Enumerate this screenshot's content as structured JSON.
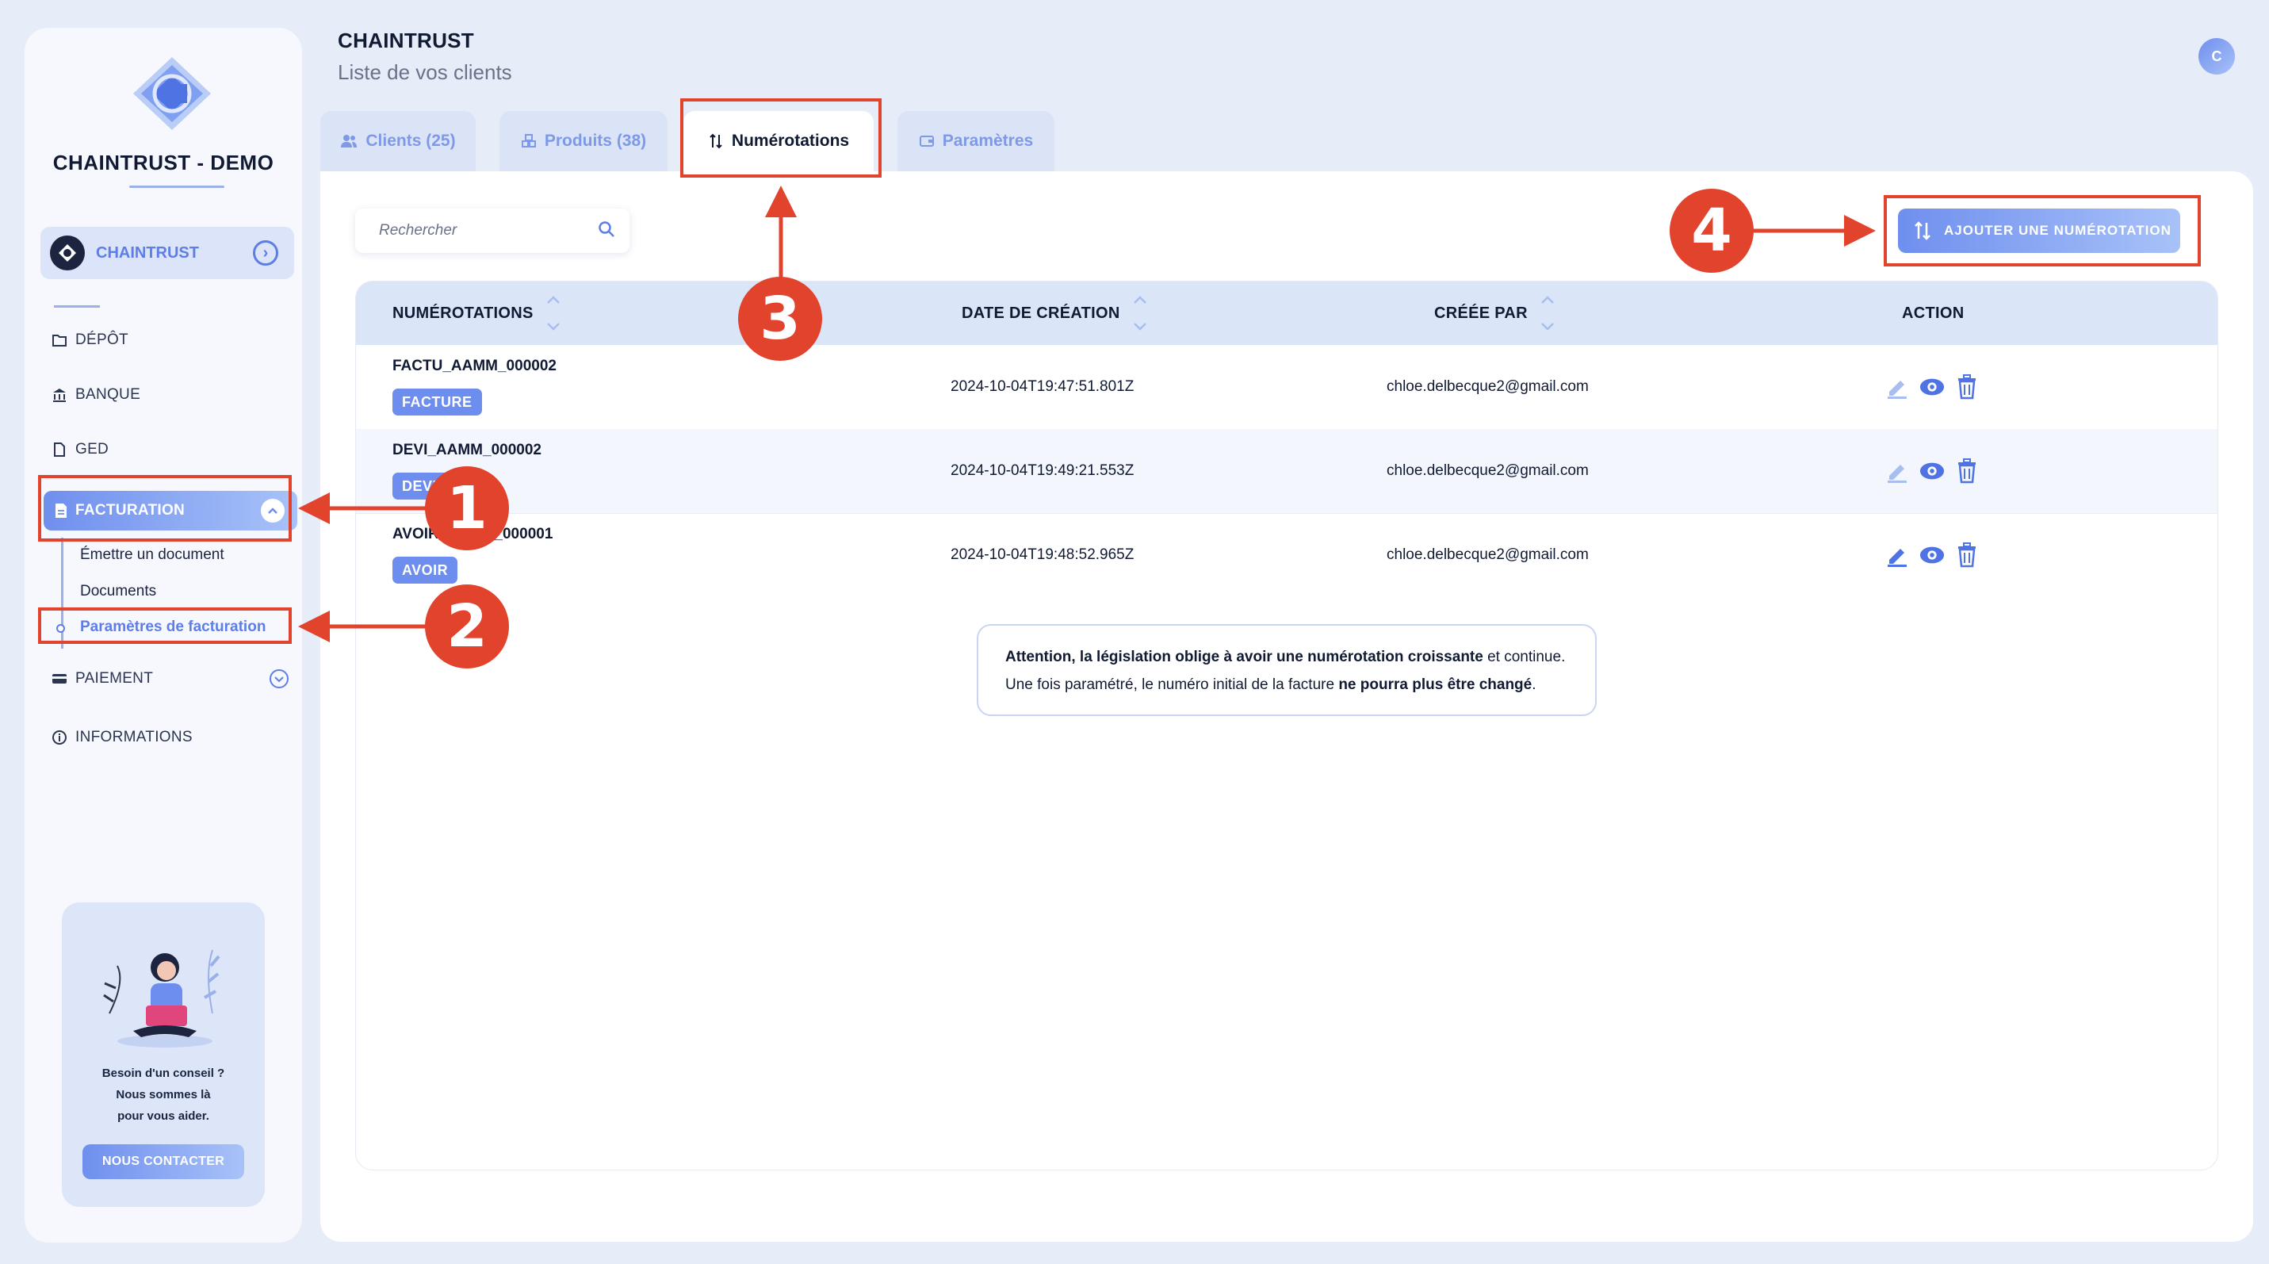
{
  "sidebar": {
    "brand": "CHAINTRUST - DEMO",
    "org_name": "CHAINTRUST",
    "nav": {
      "depot": "DÉPÔT",
      "banque": "BANQUE",
      "ged": "GED",
      "facturation": "FACTURATION",
      "paiement": "PAIEMENT",
      "informations": "INFORMATIONS"
    },
    "sub": {
      "emettre": "Émettre un document",
      "documents": "Documents",
      "parametres": "Paramètres de facturation"
    },
    "help": {
      "line1": "Besoin d'un conseil ?",
      "line2": "Nous sommes là",
      "line3": "pour vous aider.",
      "button": "NOUS CONTACTER"
    }
  },
  "header": {
    "title": "CHAINTRUST",
    "subtitle": "Liste de vos clients",
    "avatar_initial": "C"
  },
  "tabs": {
    "clients": "Clients (25)",
    "produits": "Produits (38)",
    "numerotations": "Numérotations",
    "parametres": "Paramètres"
  },
  "search": {
    "placeholder": "Rechercher"
  },
  "add_button": "AJOUTER UNE NUMÉROTATION",
  "table": {
    "headers": {
      "name": "NUMÉROTATIONS",
      "date": "DATE DE CRÉATION",
      "user": "CRÉÉE PAR",
      "action": "ACTION"
    },
    "rows": [
      {
        "name": "FACTU_AAMM_000002",
        "badge": "FACTURE",
        "date": "2024-10-04T19:47:51.801Z",
        "user": "chloe.delbecque2@gmail.com"
      },
      {
        "name": "DEVI_AAMM_000002",
        "badge": "DEVIS",
        "date": "2024-10-04T19:49:21.553Z",
        "user": "chloe.delbecque2@gmail.com"
      },
      {
        "name": "AVOIR_AAMM_000001",
        "badge": "AVOIR",
        "date": "2024-10-04T19:48:52.965Z",
        "user": "chloe.delbecque2@gmail.com"
      }
    ]
  },
  "warning": {
    "p1_bold": "Attention, la législation oblige à avoir une numérotation croissante",
    "p1_rest": " et continue.",
    "p2_start": "Une fois paramétré, le numéro initial de la facture ",
    "p2_bold": "ne pourra plus être changé",
    "p2_end": "."
  },
  "callouts": [
    "1",
    "2",
    "3",
    "4"
  ],
  "colors": {
    "accent": "#6d8eee",
    "annotation": "#e1432d",
    "background": "#e6ecf8"
  }
}
